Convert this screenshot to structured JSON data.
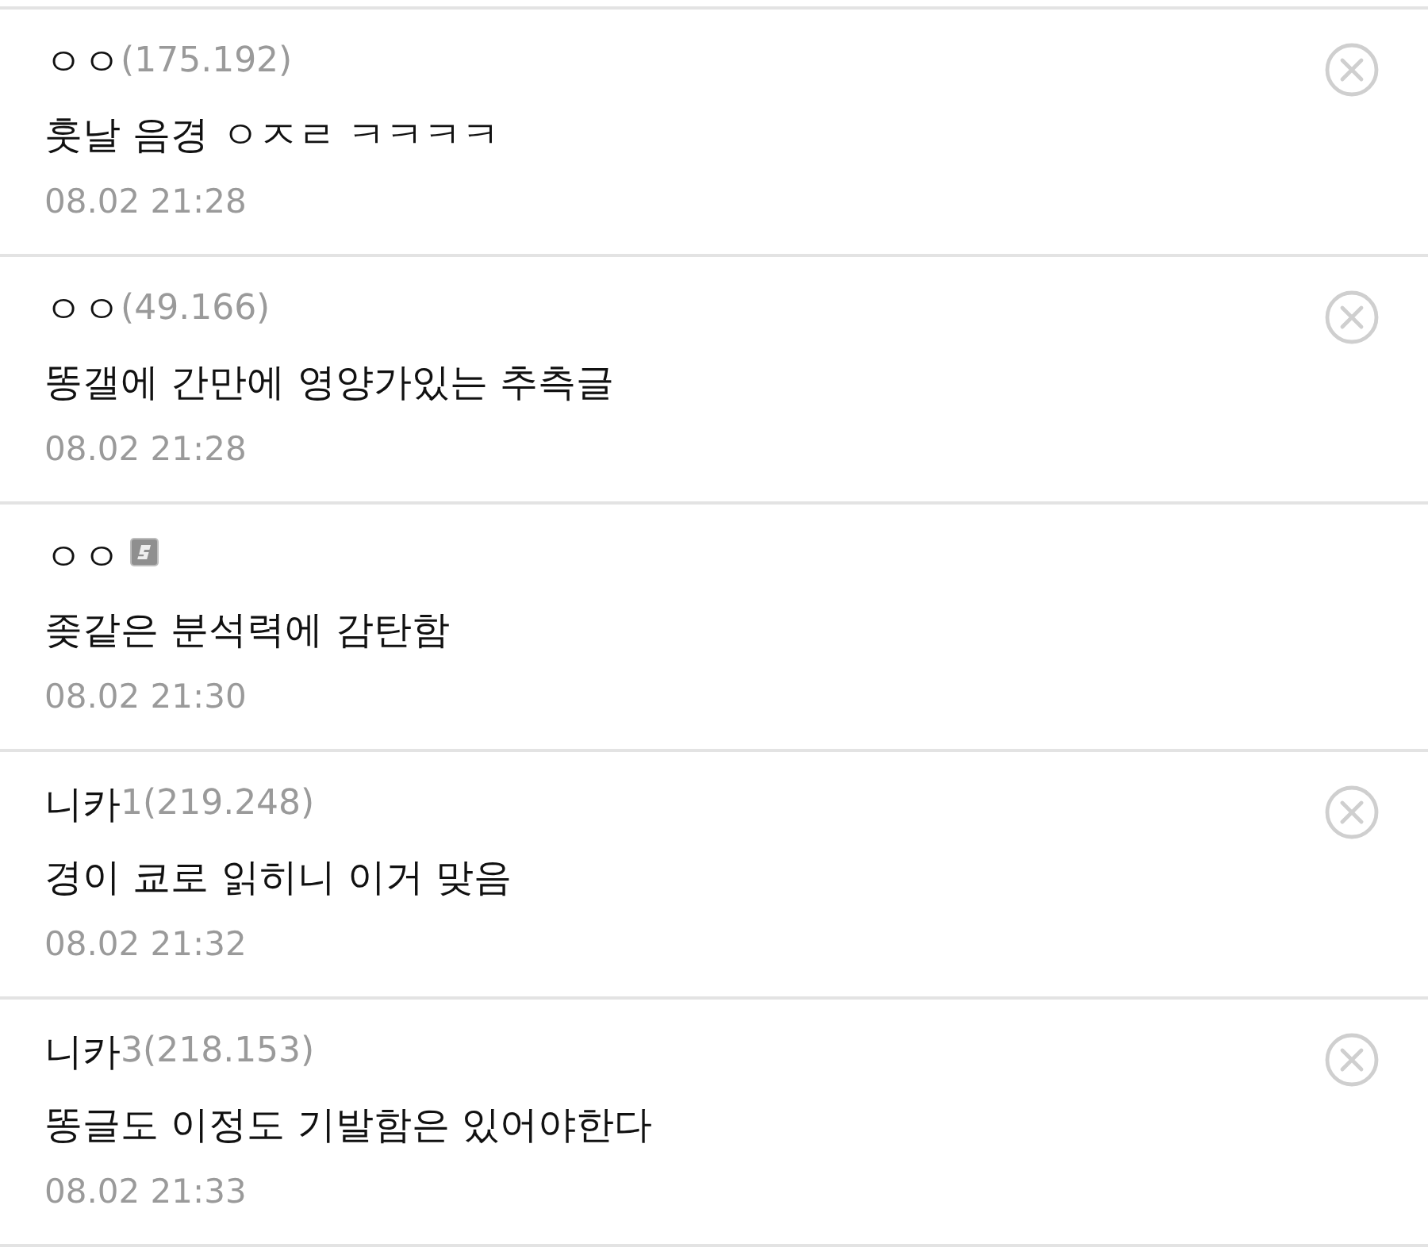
{
  "comments": [
    {
      "kind": "guest",
      "nickname": "ㅇㅇ",
      "ip": "(175.192)",
      "text": "훗날 음경 ㅇㅈㄹ ㅋㅋㅋㅋ",
      "time": "08.02 21:28"
    },
    {
      "kind": "guest",
      "nickname": "ㅇㅇ",
      "ip": "(49.166)",
      "text": "똥갤에 간만에 영양가있는 추측글",
      "time": "08.02 21:28"
    },
    {
      "kind": "member",
      "nickname": "ㅇㅇ",
      "text": "좆같은 분석력에 감탄함",
      "time": "08.02 21:30"
    },
    {
      "kind": "guest",
      "nickname": "니카",
      "ip": "1(219.248)",
      "text": "경이 쿄로 읽히니 이거 맞음",
      "time": "08.02 21:32"
    },
    {
      "kind": "guest",
      "nickname": "니카",
      "ip": "3(218.153)",
      "text": "똥글도 이정도 기발함은 있어야한다",
      "time": "08.02 21:33"
    }
  ]
}
